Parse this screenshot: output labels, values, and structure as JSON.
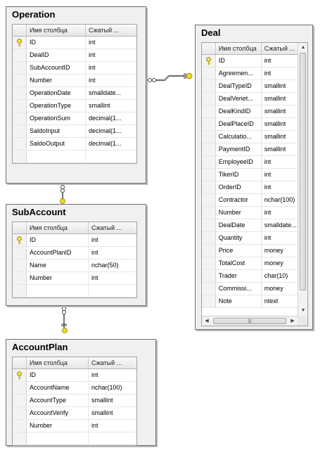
{
  "header": {
    "col_name": "Имя столбца",
    "col_type": "Сжатый ..."
  },
  "tables": {
    "operation": {
      "title": "Operation",
      "rows": [
        {
          "name": "ID",
          "type": "int",
          "key": true
        },
        {
          "name": "DealID",
          "type": "int"
        },
        {
          "name": "SubAccountID",
          "type": "int"
        },
        {
          "name": "Number",
          "type": "int"
        },
        {
          "name": "OperationDate",
          "type": "smalldate..."
        },
        {
          "name": "OperationType",
          "type": "smallint"
        },
        {
          "name": "OperationSum",
          "type": "decimal(1..."
        },
        {
          "name": "SaldoInput",
          "type": "decimal(1..."
        },
        {
          "name": "SaldoOutput",
          "type": "decimal(1..."
        }
      ]
    },
    "subaccount": {
      "title": "SubAccount",
      "rows": [
        {
          "name": "ID",
          "type": "int",
          "key": true
        },
        {
          "name": "AccountPlanID",
          "type": "int"
        },
        {
          "name": "Name",
          "type": "nchar(50)"
        },
        {
          "name": "Number",
          "type": "int"
        }
      ]
    },
    "accountplan": {
      "title": "AccountPlan",
      "rows": [
        {
          "name": "ID",
          "type": "int",
          "key": true
        },
        {
          "name": "AccountName",
          "type": "nchar(100)"
        },
        {
          "name": "AccountType",
          "type": "smallint"
        },
        {
          "name": "AccountVerify",
          "type": "smallint"
        },
        {
          "name": "Number",
          "type": "int"
        }
      ]
    },
    "deal": {
      "title": "Deal",
      "rows": [
        {
          "name": "ID",
          "type": "int",
          "key": true
        },
        {
          "name": "Agreemen...",
          "type": "int"
        },
        {
          "name": "DealTypeID",
          "type": "smallint"
        },
        {
          "name": "DealVeriet...",
          "type": "smallint"
        },
        {
          "name": "DealKindID",
          "type": "smallint"
        },
        {
          "name": "DealPlaceID",
          "type": "smallint"
        },
        {
          "name": "Calculatio...",
          "type": "smallint"
        },
        {
          "name": "PaymentID",
          "type": "smallint"
        },
        {
          "name": "EmployeeID",
          "type": "int"
        },
        {
          "name": "TikerID",
          "type": "int"
        },
        {
          "name": "OrderID",
          "type": "int"
        },
        {
          "name": "Contractor",
          "type": "nchar(100)"
        },
        {
          "name": "Number",
          "type": "int"
        },
        {
          "name": "DealDate",
          "type": "smalldate..."
        },
        {
          "name": "Quantity",
          "type": "int"
        },
        {
          "name": "Price",
          "type": "money"
        },
        {
          "name": "TotalCost",
          "type": "money"
        },
        {
          "name": "Trader",
          "type": "char(10)"
        },
        {
          "name": "Commissi...",
          "type": "money"
        },
        {
          "name": "Note",
          "type": "ntext"
        }
      ]
    }
  },
  "colors": {
    "connector": "#444444",
    "key": "#d4b21a"
  }
}
